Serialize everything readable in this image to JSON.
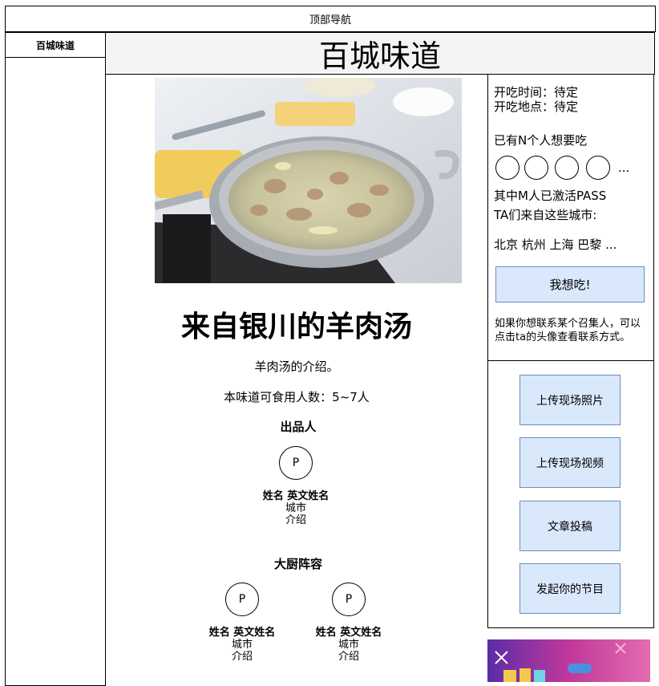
{
  "top_nav": {
    "label": "顶部导航"
  },
  "sidebar": {
    "header": "百城味道"
  },
  "page": {
    "title": "百城味道"
  },
  "dish": {
    "title": "来自银川的羊肉汤",
    "intro": "羊肉汤的介绍。",
    "serving": "本味道可食用人数：5~7人",
    "photo_icon": "mutton-soup-photo"
  },
  "producer": {
    "heading": "出品人",
    "person": {
      "avatar": "P",
      "name": "姓名 英文姓名",
      "city": "城市",
      "bio": "介绍"
    }
  },
  "chefs": {
    "heading": "大厨阵容",
    "people": [
      {
        "avatar": "P",
        "name": "姓名 英文姓名",
        "city": "城市",
        "bio": "介绍"
      },
      {
        "avatar": "P",
        "name": "姓名 英文姓名",
        "city": "城市",
        "bio": "介绍"
      }
    ]
  },
  "info": {
    "time": "开吃时间：待定",
    "place": "开吃地点：待定",
    "want_count": "已有N个人想要吃",
    "more": "...",
    "activated": "其中M人已激活PASS",
    "from_cities": "TA们来自这些城市:",
    "cities": "北京 杭州 上海 巴黎 ...",
    "want_button": "我想吃!",
    "contact_note": "如果你想联系某个召集人，可以点击ta的头像查看联系方式。"
  },
  "actions": {
    "upload_photo": "上传现场照片",
    "upload_video": "上传现场视频",
    "submit_article": "文章投稿",
    "start_program": "发起你的节目"
  },
  "colors": {
    "button_fill": "#dae8fc",
    "button_border": "#6c8ebf",
    "title_bar": "#f4f4f4"
  }
}
